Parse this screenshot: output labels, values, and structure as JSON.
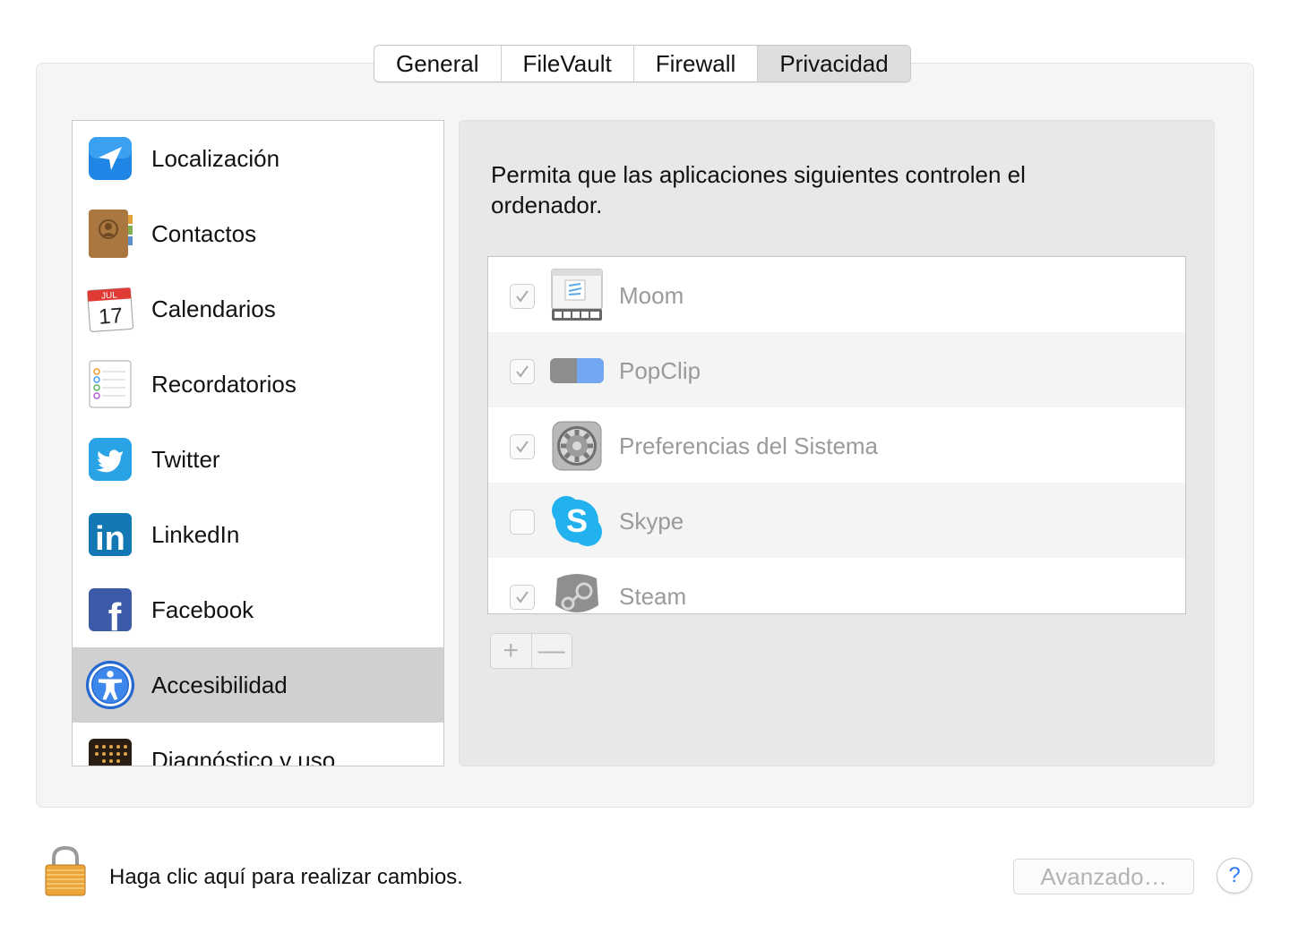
{
  "tabs": [
    {
      "label": "General",
      "selected": false
    },
    {
      "label": "FileVault",
      "selected": false
    },
    {
      "label": "Firewall",
      "selected": false
    },
    {
      "label": "Privacidad",
      "selected": true
    }
  ],
  "sidebar": {
    "items": [
      {
        "label": "Localización",
        "icon": "location-arrow-icon"
      },
      {
        "label": "Contactos",
        "icon": "contacts-book-icon"
      },
      {
        "label": "Calendarios",
        "icon": "calendar-icon",
        "calendar_month": "JUL",
        "calendar_day": "17"
      },
      {
        "label": "Recordatorios",
        "icon": "reminders-icon"
      },
      {
        "label": "Twitter",
        "icon": "twitter-bird-icon"
      },
      {
        "label": "LinkedIn",
        "icon": "linkedin-icon",
        "glyph": "in"
      },
      {
        "label": "Facebook",
        "icon": "facebook-icon",
        "glyph": "f"
      },
      {
        "label": "Accesibilidad",
        "icon": "accessibility-icon",
        "selected": true
      },
      {
        "label": "Diagnóstico y uso",
        "icon": "diagnostics-icon"
      }
    ]
  },
  "main": {
    "description": "Permita que las aplicaciones siguientes controlen el ordenador.",
    "apps": [
      {
        "name": "Moom",
        "checked": true,
        "icon": "moom-icon"
      },
      {
        "name": "PopClip",
        "checked": true,
        "icon": "popclip-icon"
      },
      {
        "name": "Preferencias del Sistema",
        "checked": true,
        "icon": "system-preferences-gear-icon"
      },
      {
        "name": "Skype",
        "checked": false,
        "icon": "skype-icon",
        "glyph": "S"
      },
      {
        "name": "Steam",
        "checked": true,
        "icon": "steam-icon"
      }
    ],
    "add_label": "+",
    "remove_label": "—"
  },
  "footer": {
    "lock_text": "Haga clic aquí para realizar cambios.",
    "advanced_label": "Avanzado…",
    "help_label": "?"
  },
  "colors": {
    "accent_blue": "#2d7cf6",
    "selected_row": "#d0d0d0",
    "twitter": "#2aa3e6",
    "linkedin": "#1178b3",
    "facebook": "#3b5ba8",
    "skype": "#22b2f0",
    "disabled_text": "#9a9a9a"
  }
}
